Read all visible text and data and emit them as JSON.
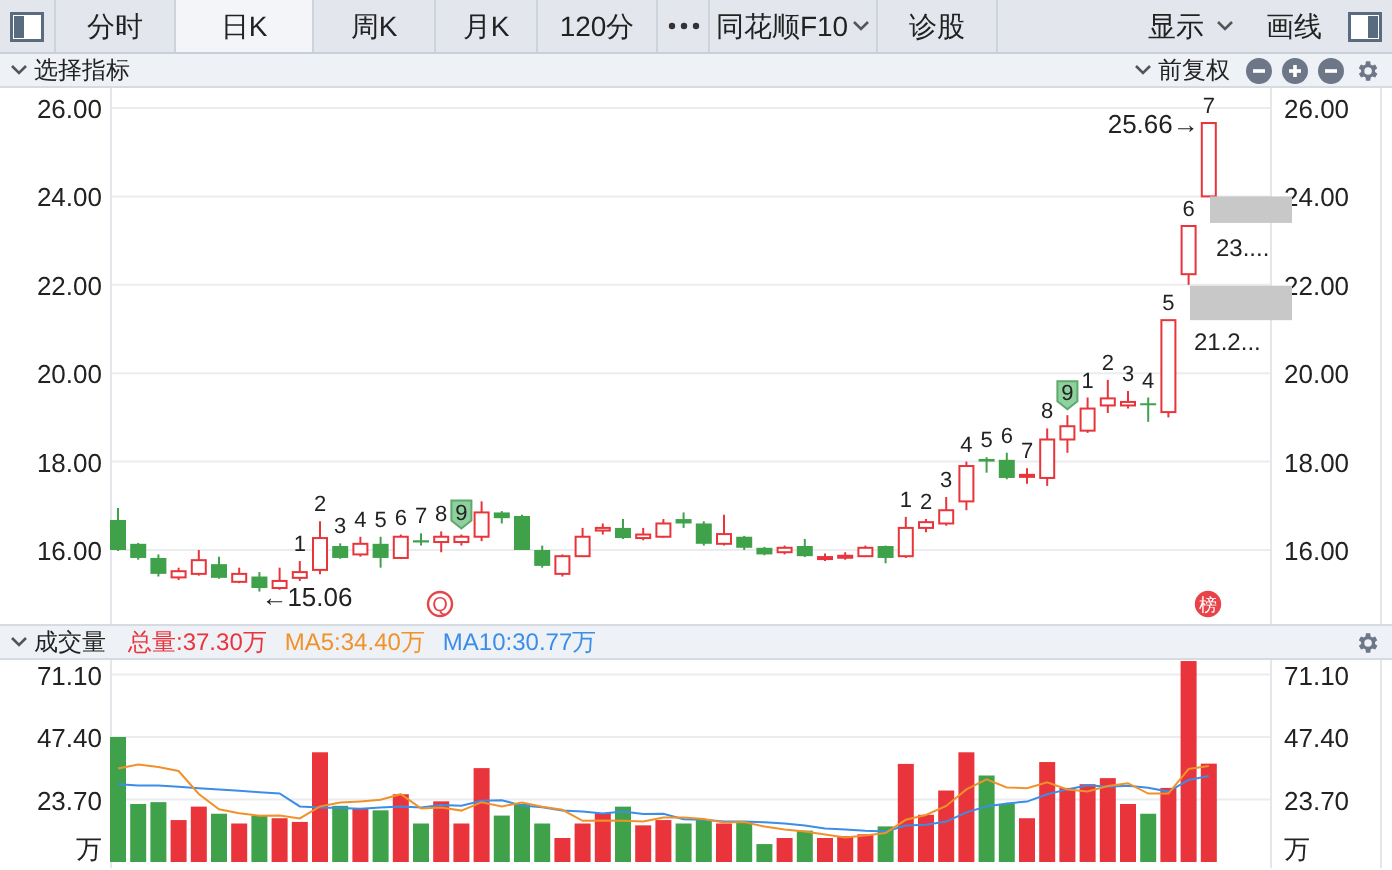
{
  "toolbar": {
    "tabs": [
      {
        "label": "分时",
        "selected": false
      },
      {
        "label": "日K",
        "selected": true
      },
      {
        "label": "周K",
        "selected": false
      },
      {
        "label": "月K",
        "selected": false
      },
      {
        "label": "120分",
        "selected": false
      }
    ],
    "more_tabs": [
      {
        "label": "同花顺F10",
        "dropdown": true
      },
      {
        "label": "诊股",
        "dropdown": false
      }
    ],
    "right_buttons": [
      {
        "label": "显示",
        "dropdown": true
      },
      {
        "label": "画线",
        "dropdown": false
      }
    ]
  },
  "indicator_bar": {
    "title": "选择指标",
    "adjustment": "前复权"
  },
  "price_chart": {
    "left_axis_labels": [
      "26.00",
      "24.00",
      "22.00",
      "20.00",
      "18.00",
      "16.00"
    ],
    "right_axis_labels": [
      "26.00",
      "24.00",
      "22.00",
      "20.00",
      "18.00",
      "16.00"
    ],
    "count_labels": [
      {
        "text": "1",
        "kind": "plain"
      },
      {
        "text": "2",
        "kind": "plain"
      },
      {
        "text": "3",
        "kind": "plain"
      },
      {
        "text": "4",
        "kind": "plain"
      },
      {
        "text": "5",
        "kind": "plain"
      },
      {
        "text": "6",
        "kind": "plain"
      },
      {
        "text": "7",
        "kind": "plain"
      },
      {
        "text": "8",
        "kind": "plain"
      },
      {
        "text": "9",
        "kind": "badge"
      },
      {
        "text": "1",
        "kind": "plain"
      },
      {
        "text": "2",
        "kind": "plain"
      },
      {
        "text": "3",
        "kind": "plain"
      },
      {
        "text": "4",
        "kind": "plain"
      },
      {
        "text": "5",
        "kind": "plain"
      },
      {
        "text": "6",
        "kind": "plain"
      },
      {
        "text": "7",
        "kind": "plain"
      },
      {
        "text": "8",
        "kind": "plain"
      },
      {
        "text": "9",
        "kind": "badge"
      },
      {
        "text": "1",
        "kind": "plain"
      },
      {
        "text": "2",
        "kind": "plain"
      },
      {
        "text": "3",
        "kind": "plain"
      },
      {
        "text": "4",
        "kind": "plain"
      },
      {
        "text": "5",
        "kind": "plain"
      },
      {
        "text": "6",
        "kind": "plain"
      },
      {
        "text": "7",
        "kind": "plain"
      }
    ],
    "low_label": "←15.06",
    "high_label": "25.66→",
    "gap_labels": [
      "23....",
      "21.2..."
    ],
    "event_markers": [
      {
        "text": "Q",
        "kind": "outline"
      },
      {
        "text": "榜",
        "kind": "filled"
      }
    ]
  },
  "volume_panel": {
    "title": "成交量",
    "legend": [
      {
        "text": "总量:37.30万",
        "color": "#e8343a"
      },
      {
        "text": "MA5:34.40万",
        "color": "#f0922b"
      },
      {
        "text": "MA10:30.77万",
        "color": "#3b8ee8"
      }
    ],
    "right_axis_labels": [
      "71.10",
      "47.40",
      "23.70"
    ],
    "unit_left": "万",
    "unit_right": "万",
    "chart_data": {
      "type": "bar",
      "stacked": true,
      "grid": true,
      "ylim": [
        0,
        76.6
      ],
      "yticks": [
        {
          "value": 71.1,
          "label": "71.10"
        },
        {
          "value": 47.4,
          "label": "47.40"
        },
        {
          "value": 23.7,
          "label": "23.70"
        }
      ],
      "series": [
        {
          "type": "bar",
          "color": "#e8343a",
          "values": [
            null,
            null,
            null,
            15.9,
            21.0,
            null,
            14.6,
            null,
            16.6,
            15.2,
            41.6,
            null,
            20.3,
            null,
            25.7,
            null,
            23.0,
            14.6,
            35.6,
            null,
            null,
            null,
            9.1,
            14.6,
            18.6,
            null,
            13.9,
            15.9,
            null,
            null,
            14.6,
            null,
            null,
            9.1,
            null,
            9.1,
            9.8,
            10.5,
            null,
            37.2,
            17.9,
            27.1,
            41.6,
            null,
            null,
            16.6,
            37.9,
            28.1,
            29.5,
            31.8,
            22.0,
            null,
            28.1,
            76.2,
            37.3
          ]
        },
        {
          "type": "bar",
          "color": "#3fa24b",
          "values": [
            47.4,
            22.0,
            22.7,
            null,
            null,
            18.3,
            null,
            17.6,
            null,
            null,
            null,
            21.3,
            null,
            19.6,
            null,
            14.6,
            null,
            null,
            null,
            17.6,
            22.0,
            14.6,
            null,
            null,
            null,
            21.0,
            null,
            null,
            14.6,
            15.9,
            null,
            15.2,
            6.8,
            null,
            11.9,
            null,
            null,
            null,
            13.5,
            null,
            null,
            null,
            null,
            32.8,
            22.0,
            null,
            null,
            null,
            null,
            null,
            null,
            18.3,
            null,
            null,
            null
          ]
        },
        {
          "type": "line",
          "color": "#3b8ee8",
          "values": [
            29.5,
            29.0,
            29.0,
            28.5,
            28.0,
            27.5,
            27.0,
            26.5,
            26.0,
            21.1,
            20.6,
            20.5,
            20.2,
            20.6,
            21.1,
            20.7,
            21.6,
            21.3,
            23.2,
            23.4,
            21.4,
            20.8,
            19.6,
            19.1,
            18.4,
            19.1,
            18.2,
            18.3,
            16.2,
            16.0,
            15.3,
            15.3,
            15.1,
            14.6,
            13.9,
            12.7,
            12.3,
            11.8,
            11.6,
            13.8,
            14.1,
            15.3,
            18.8,
            21.1,
            22.2,
            22.9,
            25.7,
            27.5,
            29.1,
            28.5,
            28.9,
            28.1,
            26.7,
            31.1,
            32.6
          ]
        },
        {
          "type": "line",
          "color": "#f0922b",
          "values": [
            35.5,
            37.0,
            36.0,
            34.5,
            25.8,
            20.0,
            18.5,
            17.5,
            17.6,
            16.5,
            21.1,
            22.5,
            23.0,
            23.6,
            25.7,
            20.3,
            20.6,
            19.5,
            22.7,
            21.1,
            22.6,
            20.9,
            19.8,
            15.6,
            15.8,
            15.6,
            15.4,
            16.8,
            16.8,
            16.3,
            15.0,
            15.2,
            13.4,
            12.3,
            11.5,
            10.4,
            9.3,
            10.1,
            11.0,
            16.0,
            17.8,
            21.2,
            27.5,
            31.3,
            28.3,
            28.0,
            30.2,
            27.5,
            26.8,
            28.8,
            29.9,
            25.9,
            25.9,
            35.3,
            36.4
          ]
        }
      ]
    }
  }
}
